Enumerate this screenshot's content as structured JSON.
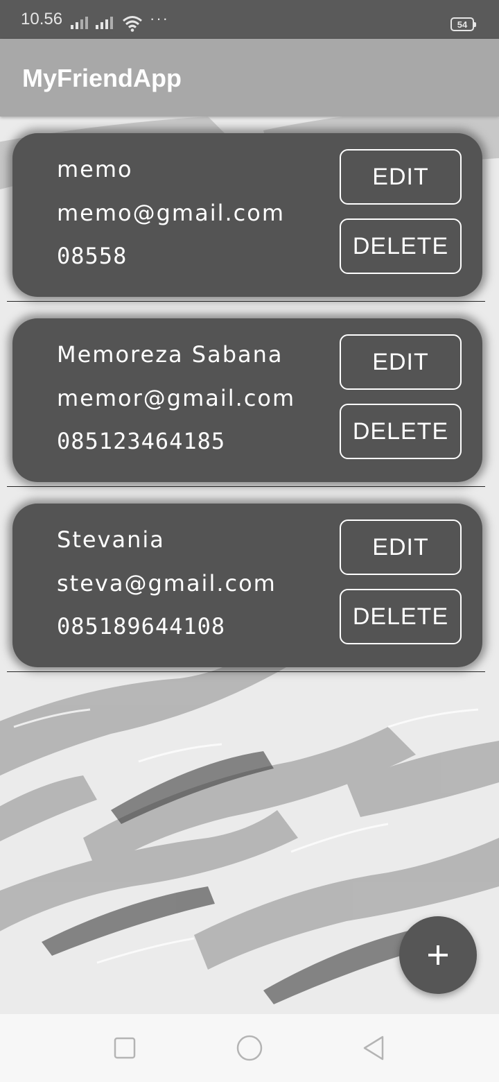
{
  "status_bar": {
    "time": "10.56",
    "dots": "···",
    "battery": "54"
  },
  "app_bar": {
    "title": "MyFriendApp"
  },
  "friends": [
    {
      "name": "memo",
      "email": "memo@gmail.com",
      "phone": "08558",
      "edit_label": "EDIT",
      "delete_label": "DELETE"
    },
    {
      "name": "Memoreza Sabana",
      "email": "memor@gmail.com",
      "phone": "085123464185",
      "edit_label": "EDIT",
      "delete_label": "DELETE"
    },
    {
      "name": "Stevania",
      "email": "steva@gmail.com",
      "phone": "085189644108",
      "edit_label": "EDIT",
      "delete_label": "DELETE"
    }
  ],
  "fab": {
    "icon": "plus-icon"
  },
  "nav_bar": {
    "icons": [
      "square-recents-icon",
      "circle-home-icon",
      "triangle-back-icon"
    ]
  },
  "colors": {
    "card": "#545454",
    "app_bar": "#a8a8a8",
    "status_bar": "#5a5a5a",
    "fab": "#565656"
  }
}
